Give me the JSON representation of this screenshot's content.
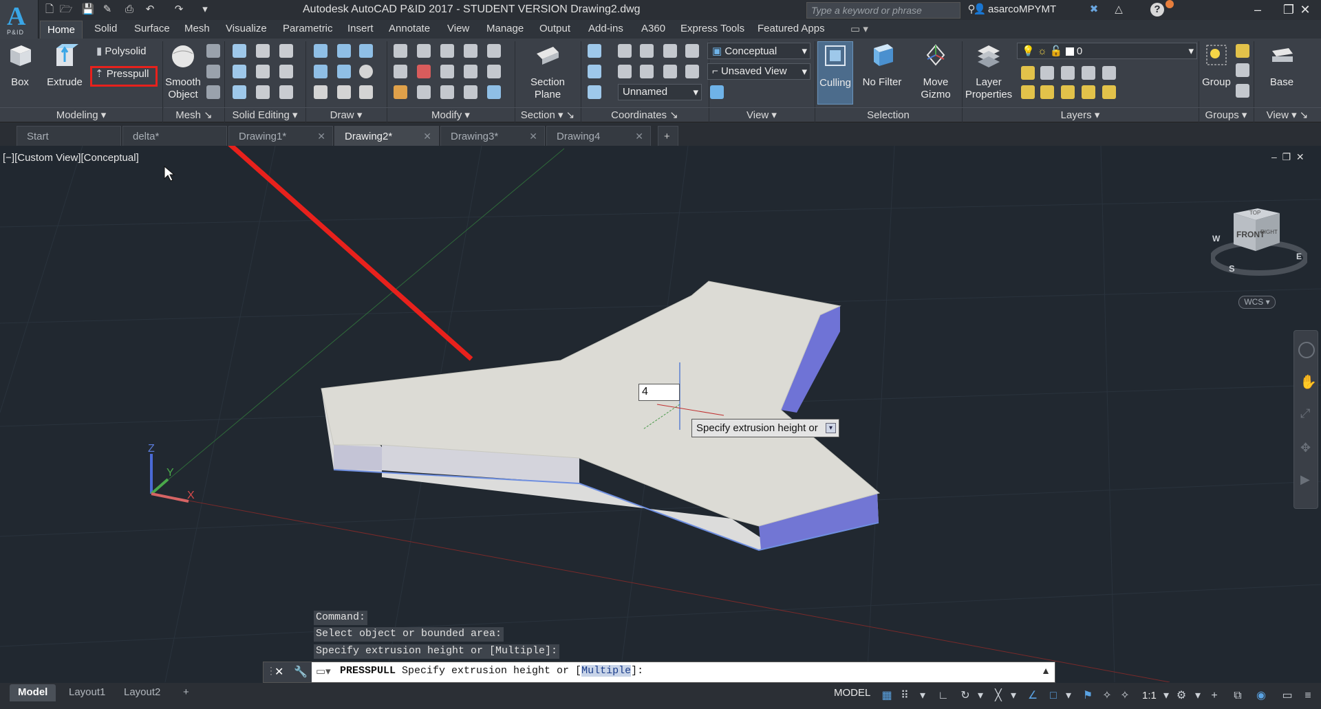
{
  "app": {
    "logo_text": "A",
    "logo_sub": "P&ID",
    "title": "Autodesk AutoCAD P&ID 2017 - STUDENT VERSION    Drawing2.dwg",
    "search_placeholder": "Type a keyword or phrase",
    "user": "asarcoMPYMT"
  },
  "menus": [
    "Home",
    "Solid",
    "Surface",
    "Mesh",
    "Visualize",
    "Parametric",
    "Insert",
    "Annotate",
    "View",
    "Manage",
    "Output",
    "Add-ins",
    "A360",
    "Express Tools",
    "Featured Apps"
  ],
  "ribbon": {
    "box": "Box",
    "extrude": "Extrude",
    "polysolid": "Polysolid",
    "presspull": "Presspull",
    "smooth1": "Smooth",
    "smooth2": "Object",
    "section1": "Section",
    "section2": "Plane",
    "visual_style": "Conceptual",
    "view_state": "Unsaved View",
    "ucs_name": "Unnamed",
    "culling": "Culling",
    "nofilter": "No Filter",
    "move1": "Move",
    "move2": "Gizmo",
    "layerprops1": "Layer",
    "layerprops2": "Properties",
    "layer_name": "0",
    "group": "Group",
    "base": "Base",
    "panels": {
      "modeling": "Modeling",
      "mesh": "Mesh",
      "solid_editing": "Solid Editing",
      "draw": "Draw",
      "modify": "Modify",
      "section": "Section",
      "coordinates": "Coordinates",
      "view": "View",
      "selection": "Selection",
      "layers": "Layers",
      "groups": "Groups",
      "view2": "View"
    }
  },
  "file_tabs": [
    "Start",
    "delta*",
    "Drawing1*",
    "Drawing2*",
    "Drawing3*",
    "Drawing4"
  ],
  "viewport": {
    "label": "[−][Custom View][Conceptual]",
    "dyn_input": "4",
    "tooltip": "Specify extrusion height or",
    "wcs": "WCS",
    "cube_front": "FRONT",
    "cube_top": "TOP",
    "cube_right": "RIGHT",
    "compass_w": "W",
    "compass_s": "S",
    "compass_e": "E",
    "axis_x": "X",
    "axis_y": "Y",
    "axis_z": "Z"
  },
  "command": {
    "history": [
      "Command:",
      "Select object or bounded area:",
      "Specify extrusion height or [Multiple]:"
    ],
    "prompt_cmd": "PRESSPULL",
    "prompt_text": " Specify extrusion height or [",
    "prompt_opt": "Multiple",
    "prompt_end": "]:"
  },
  "status": {
    "layouts": [
      "Model",
      "Layout1",
      "Layout2"
    ],
    "mode": "MODEL",
    "scale": "1:1"
  },
  "colors": {
    "accent": "#3aa6e6",
    "highlight": "#e8211c",
    "solid_top": "#dcdbd5",
    "solid_side": "#6f73d6"
  }
}
